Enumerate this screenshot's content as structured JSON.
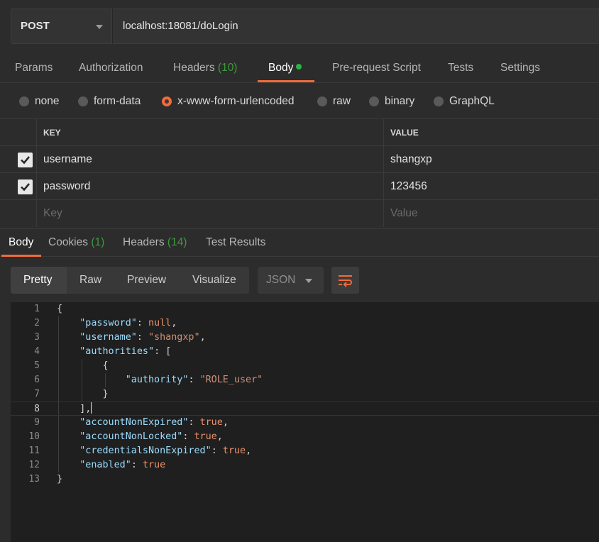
{
  "request": {
    "method": "POST",
    "url": "localhost:18081/doLogin"
  },
  "request_tabs": [
    {
      "label": "Params"
    },
    {
      "label": "Authorization"
    },
    {
      "label": "Headers",
      "count": "(10)"
    },
    {
      "label": "Body"
    },
    {
      "label": "Pre-request Script"
    },
    {
      "label": "Tests"
    },
    {
      "label": "Settings"
    }
  ],
  "body_types": [
    "none",
    "form-data",
    "x-www-form-urlencoded",
    "raw",
    "binary",
    "GraphQL"
  ],
  "body_type_selected": "x-www-form-urlencoded",
  "params_table": {
    "headers": {
      "key": "KEY",
      "value": "VALUE"
    },
    "rows": [
      {
        "checked": true,
        "key": "username",
        "value": "shangxp"
      },
      {
        "checked": true,
        "key": "password",
        "value": "123456"
      }
    ],
    "placeholder": {
      "key": "Key",
      "value": "Value"
    }
  },
  "response_tabs": [
    {
      "label": "Body"
    },
    {
      "label": "Cookies",
      "count": "(1)"
    },
    {
      "label": "Headers",
      "count": "(14)"
    },
    {
      "label": "Test Results"
    }
  ],
  "view_modes": [
    "Pretty",
    "Raw",
    "Preview",
    "Visualize"
  ],
  "format": "JSON",
  "code_lines": [
    "1",
    "2",
    "3",
    "4",
    "5",
    "6",
    "7",
    "8",
    "9",
    "10",
    "11",
    "12",
    "13"
  ],
  "response_json": {
    "password_key": "\"password\"",
    "password_val": "null",
    "username_key": "\"username\"",
    "username_val": "\"shangxp\"",
    "authorities_key": "\"authorities\"",
    "authority_key": "\"authority\"",
    "authority_val": "\"ROLE_user\"",
    "accountNonExpired_key": "\"accountNonExpired\"",
    "accountNonExpired_val": "true",
    "accountNonLocked_key": "\"accountNonLocked\"",
    "accountNonLocked_val": "true",
    "credentialsNonExpired_key": "\"credentialsNonExpired\"",
    "credentialsNonExpired_val": "true",
    "enabled_key": "\"enabled\"",
    "enabled_val": "true"
  },
  "colors": {
    "accent": "#f26b3a",
    "status_green": "#2bb345",
    "json_key": "#9cdcfe",
    "json_string": "#ce9178"
  }
}
